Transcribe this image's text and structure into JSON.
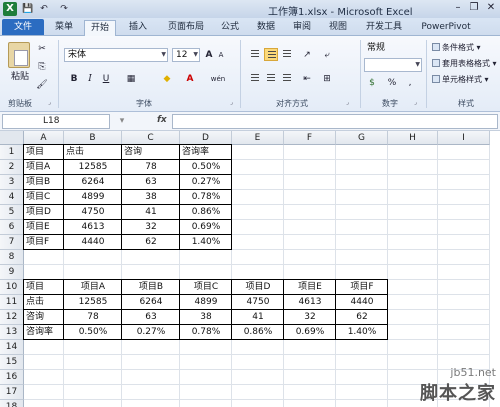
{
  "window": {
    "title": "工作簿1.xlsx - Microsoft Excel",
    "minimize": "–",
    "restore": "❐",
    "close": "✕",
    "logo": "X"
  },
  "qat": [
    "💾",
    "↶",
    "↷"
  ],
  "tabs": [
    "文件",
    "菜单",
    "开始",
    "插入",
    "页面布局",
    "公式",
    "数据",
    "审阅",
    "视图",
    "开发工具",
    "PowerPivot"
  ],
  "ribbon": {
    "clipboard": {
      "paste": "粘贴",
      "label": "剪贴板"
    },
    "font": {
      "name": "宋体",
      "size": "12",
      "grow": "A",
      "shrink": "A",
      "bold": "B",
      "italic": "I",
      "underline": "U",
      "fill_letter": "A",
      "wen": "wén",
      "label": "字体"
    },
    "alignment": {
      "label": "对齐方式"
    },
    "number": {
      "format": "常规",
      "percent": "%",
      "comma": ",",
      "currency": "$",
      "label": "数字"
    },
    "styles": {
      "items": [
        "条件格式",
        "套用表格格式",
        "单元格样式"
      ],
      "label": "样式"
    }
  },
  "formula_bar": {
    "name_box": "L18",
    "fx": "fx"
  },
  "grid": {
    "columns": [
      "A",
      "B",
      "C",
      "D",
      "E",
      "F",
      "G",
      "H",
      "I"
    ],
    "rows": [
      "1",
      "2",
      "3",
      "4",
      "5",
      "6",
      "7",
      "8",
      "9",
      "10",
      "11",
      "12",
      "13",
      "14",
      "15",
      "16",
      "17",
      "18"
    ],
    "table1": [
      [
        "项目",
        "点击",
        "咨询",
        "咨询率"
      ],
      [
        "项目A",
        "12585",
        "78",
        "0.50%"
      ],
      [
        "项目B",
        "6264",
        "63",
        "0.27%"
      ],
      [
        "项目C",
        "4899",
        "38",
        "0.78%"
      ],
      [
        "项目D",
        "4750",
        "41",
        "0.86%"
      ],
      [
        "项目E",
        "4613",
        "32",
        "0.69%"
      ],
      [
        "项目F",
        "4440",
        "62",
        "1.40%"
      ]
    ],
    "table2": [
      [
        "项目",
        "项目A",
        "项目B",
        "项目C",
        "项目D",
        "项目E",
        "项目F"
      ],
      [
        "点击",
        "12585",
        "6264",
        "4899",
        "4750",
        "4613",
        "4440"
      ],
      [
        "咨询",
        "78",
        "63",
        "38",
        "41",
        "32",
        "62"
      ],
      [
        "咨询率",
        "0.50%",
        "0.27%",
        "0.78%",
        "0.86%",
        "0.69%",
        "1.40%"
      ]
    ]
  },
  "watermark": {
    "url": "jb51.net",
    "name": "脚本之家"
  }
}
